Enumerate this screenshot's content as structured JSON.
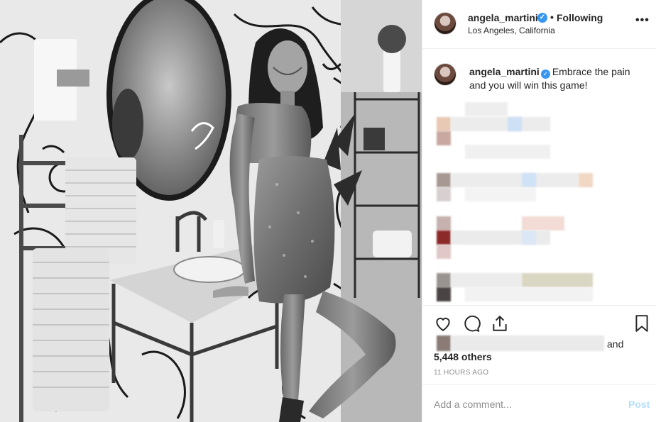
{
  "post": {
    "photo_alt": "Black and white photo of a woman in a sequined mini dress posing next to a bathroom vanity with a round mirror and line-art wallpaper"
  },
  "header": {
    "username": "angela_martini",
    "separator": "•",
    "follow_status": "Following",
    "location": "Los Angeles, California",
    "more_label": "•••"
  },
  "caption": {
    "username": "angela_martini",
    "text": "Embrace the pain and you will win this game!"
  },
  "engagement": {
    "liked_by_suffix": "and",
    "others_count": "5,448 others",
    "timestamp": "11 HOURS AGO"
  },
  "comment_box": {
    "placeholder": "Add a comment...",
    "post_label": "Post"
  },
  "icons": {
    "like": "heart-icon",
    "comment": "comment-bubble-icon",
    "share": "share-icon",
    "save": "bookmark-icon",
    "verified": "verified-badge-icon"
  },
  "colors": {
    "verified_blue": "#3897f0",
    "post_disabled": "#b2dffc",
    "muted_text": "#8e8e8e",
    "divider": "#efefef"
  }
}
